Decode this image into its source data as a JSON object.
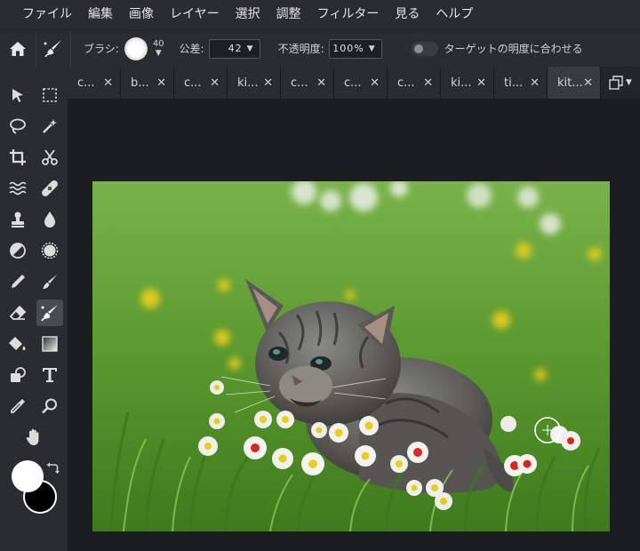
{
  "menu": [
    "ファイル",
    "編集",
    "画像",
    "レイヤー",
    "選択",
    "調整",
    "フィルター",
    "見る",
    "ヘルプ"
  ],
  "options": {
    "brush_label": "ブラシ:",
    "brush_size": "40",
    "tolerance_label": "公差:",
    "tolerance_value": "42",
    "opacity_label": "不透明度:",
    "opacity_value": "100%",
    "target_toggle_label": "ターゲットの明度に合わせる"
  },
  "tabs": [
    {
      "label": "c...",
      "active": false
    },
    {
      "label": "b...",
      "active": false
    },
    {
      "label": "c...",
      "active": false
    },
    {
      "label": "ki...",
      "active": false
    },
    {
      "label": "c...",
      "active": false
    },
    {
      "label": "c...",
      "active": false
    },
    {
      "label": "c...",
      "active": false
    },
    {
      "label": "ki...",
      "active": false
    },
    {
      "label": "ti...",
      "active": false
    },
    {
      "label": "kit...",
      "active": true
    }
  ],
  "tab_close_glyph": "✕",
  "tools": [
    "move-tool",
    "marquee-tool",
    "lasso-tool",
    "magic-wand-tool",
    "crop-tool",
    "slice-tool",
    "liquify-tool",
    "healing-tool",
    "clone-stamp-tool",
    "blur-tool",
    "dodge-tool",
    "sponge-tool",
    "pencil-tool",
    "brush-tool",
    "eraser-tool",
    "color-replace-tool",
    "paint-bucket-tool",
    "gradient-tool",
    "shape-tool",
    "text-tool",
    "eyedropper-tool",
    "zoom-tool",
    "hand-tool"
  ],
  "colors": {
    "foreground": "#ffffff",
    "background": "#000000",
    "active_tool_bg": "#4a4b4f"
  },
  "canvas_image": "kitten sitting in green grass with white daisies"
}
